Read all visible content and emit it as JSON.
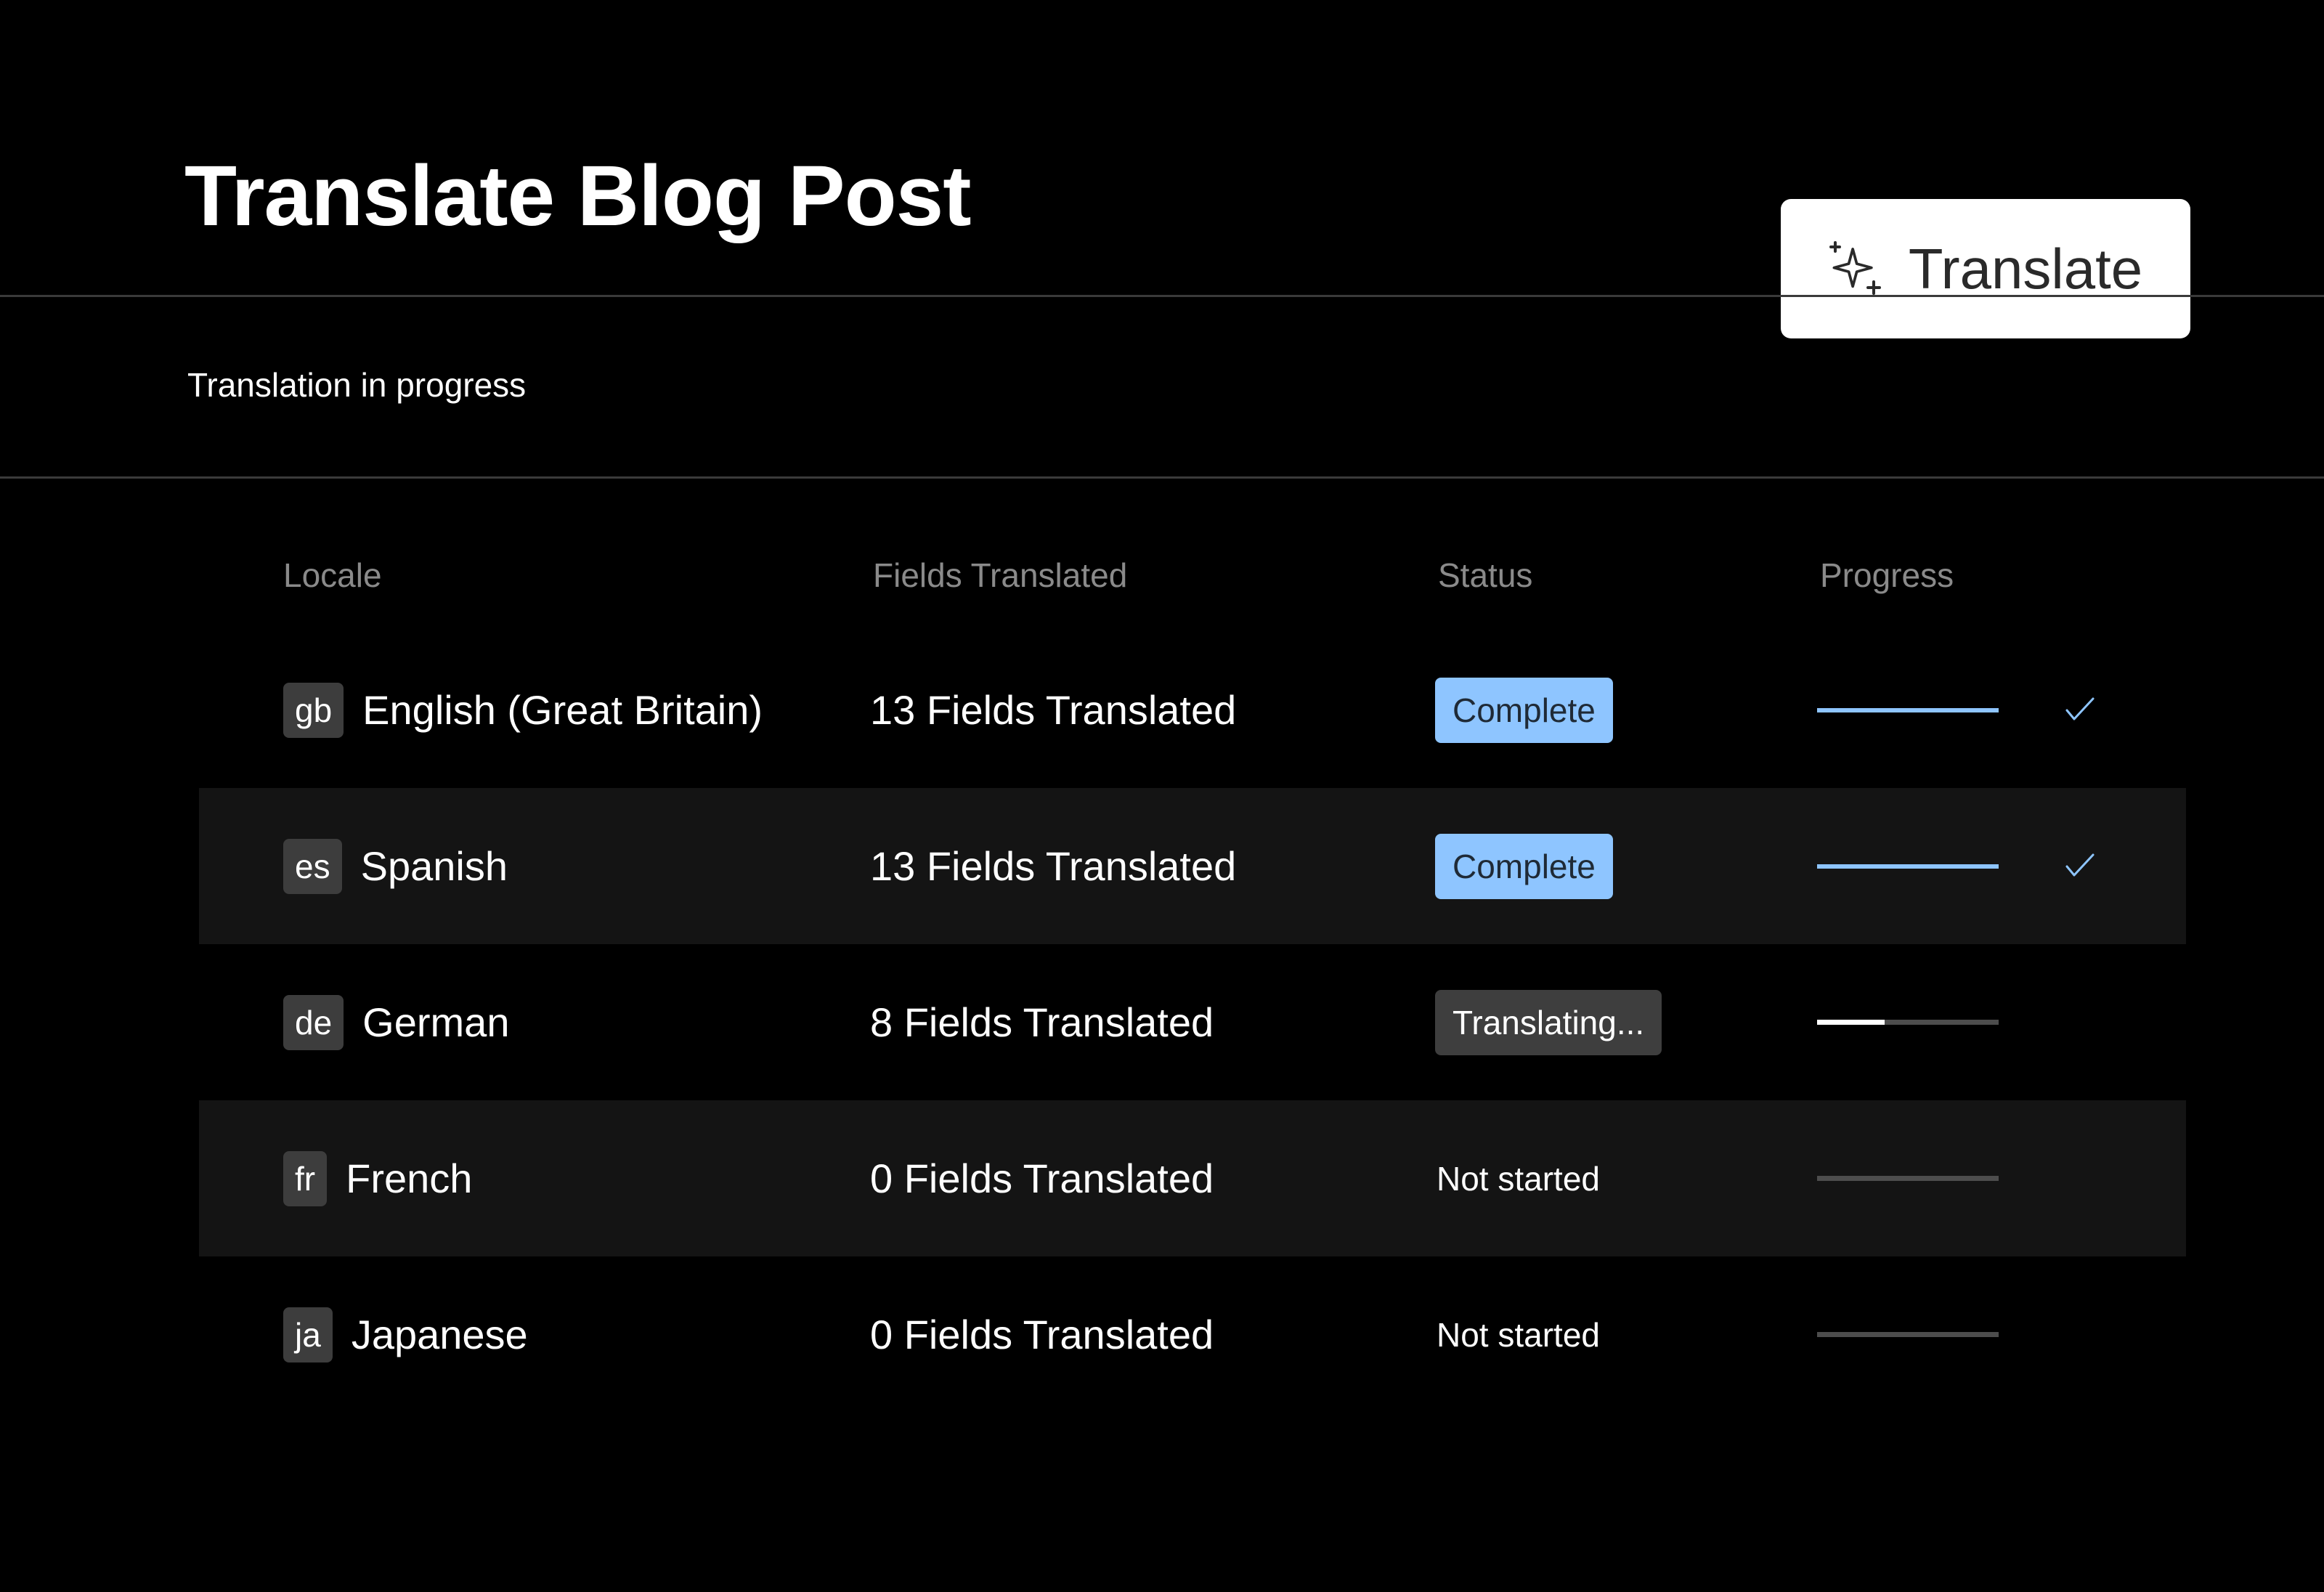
{
  "header": {
    "title": "Translate Blog Post",
    "subtitle": "Translation in progress",
    "translate_button": {
      "label": "Translate",
      "icon": "sparkles-icon"
    }
  },
  "table": {
    "columns": [
      "Locale",
      "Fields Translated",
      "Status",
      "Progress"
    ],
    "rows": [
      {
        "code": "gb",
        "name": "English (Great Britain)",
        "fields": "13 Fields Translated",
        "status": "Complete",
        "status_kind": "complete",
        "progress": 1.0,
        "done": true
      },
      {
        "code": "es",
        "name": "Spanish",
        "fields": "13 Fields Translated",
        "status": "Complete",
        "status_kind": "complete",
        "progress": 1.0,
        "done": true
      },
      {
        "code": "de",
        "name": "German",
        "fields": "8 Fields Translated",
        "status": "Translating...",
        "status_kind": "translating",
        "progress": 0.37,
        "done": false
      },
      {
        "code": "fr",
        "name": "French",
        "fields": "0 Fields Translated",
        "status": "Not started",
        "status_kind": "notstarted",
        "progress": 0,
        "done": false
      },
      {
        "code": "ja",
        "name": "Japanese",
        "fields": "0 Fields Translated",
        "status": "Not started",
        "status_kind": "notstarted",
        "progress": 0,
        "done": false
      }
    ]
  },
  "colors": {
    "accent": "#8ec5ff",
    "in_progress_fill": "#ffffff",
    "track": "#4d4d4d",
    "stripe": "#141414"
  }
}
